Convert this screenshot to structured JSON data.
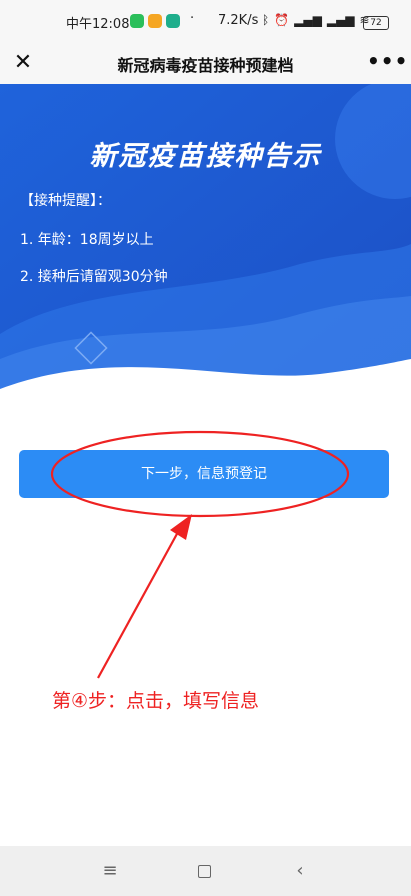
{
  "status_bar": {
    "time": "中午12:08",
    "dot": "·",
    "speed": "7.2K/s",
    "battery": "72",
    "icons": [
      "wechat-icon",
      "app-icon",
      "shield-app-icon",
      "bluetooth-icon",
      "alarm-icon",
      "signal-icon",
      "signal-icon",
      "wifi-icon",
      "battery-icon"
    ]
  },
  "nav": {
    "title": "新冠病毒疫苗接种预建档",
    "close_icon": "close-icon",
    "more_icon": "more-icon"
  },
  "banner": {
    "title": "新冠疫苗接种告示",
    "reminder_heading": "【接种提醒】：",
    "reminder_1": "1. 年龄：18周岁以上",
    "reminder_2": "2. 接种后请留观30分钟"
  },
  "button": {
    "label": "下一步，信息预登记"
  },
  "annotation": {
    "text": "第④步：点击，填写信息",
    "color": "#ee2222"
  },
  "bottom_nav": {
    "icons": [
      "menu-icon",
      "home-icon",
      "back-icon"
    ]
  },
  "colors": {
    "banner_blue": "#1e5fd8",
    "button_blue": "#2c8cf5"
  }
}
